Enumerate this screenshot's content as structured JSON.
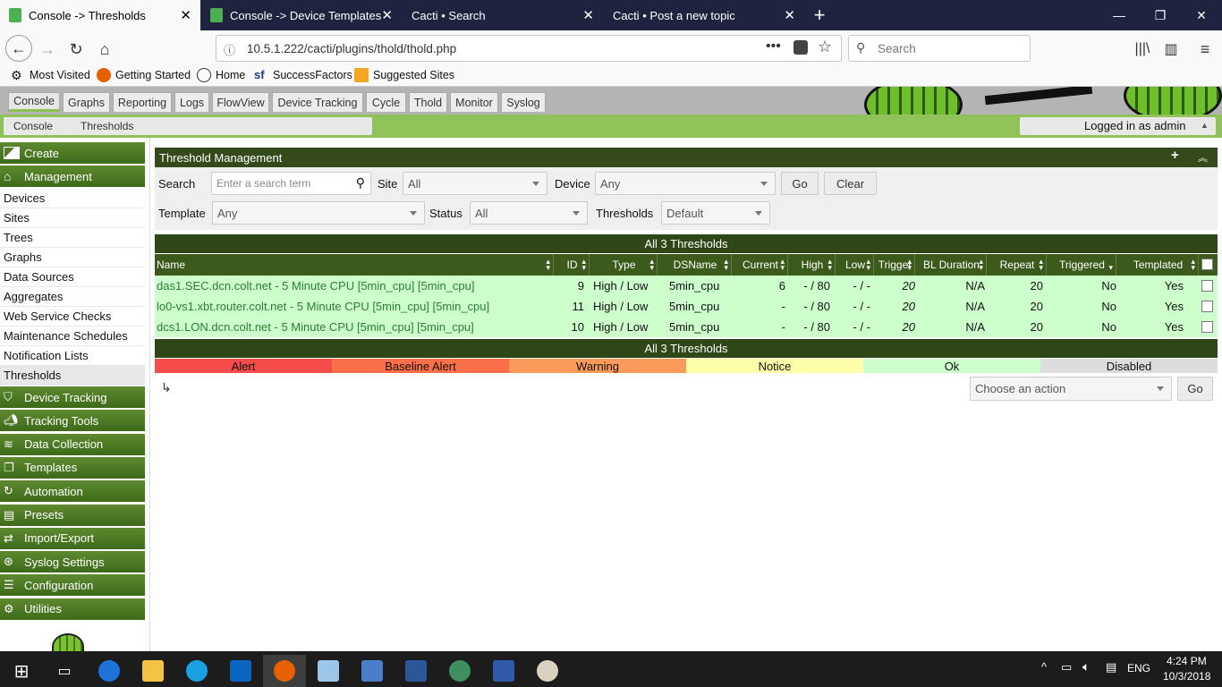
{
  "browser": {
    "tabs": [
      {
        "title": "Console -> Thresholds",
        "active": true
      },
      {
        "title": "Console -> Device Templates",
        "active": false
      },
      {
        "title": "Cacti • Search",
        "active": false
      },
      {
        "title": "Cacti • Post a new topic",
        "active": false
      }
    ],
    "url": "10.5.1.222/cacti/plugins/thold/thold.php",
    "search_placeholder": "Search",
    "bookmarks": [
      "Most Visited",
      "Getting Started",
      "Home",
      "SuccessFactors",
      "Suggested Sites"
    ]
  },
  "cacti": {
    "tabs": [
      "Console",
      "Graphs",
      "Reporting",
      "Logs",
      "FlowView",
      "Device Tracking",
      "Cycle",
      "Thold",
      "Monitor",
      "Syslog"
    ],
    "selected_tab": "Console",
    "breadcrumb": [
      "Console",
      "Thresholds"
    ],
    "logged_in": "Logged in as admin"
  },
  "sidebar": {
    "create": "Create",
    "management": "Management",
    "management_items": [
      "Devices",
      "Sites",
      "Trees",
      "Graphs",
      "Data Sources",
      "Aggregates",
      "Web Service Checks",
      "Maintenance Schedules",
      "Notification Lists",
      "Thresholds"
    ],
    "selected_item": "Thresholds",
    "sections": [
      "Device Tracking",
      "Tracking Tools",
      "Data Collection",
      "Templates",
      "Automation",
      "Presets",
      "Import/Export",
      "Syslog Settings",
      "Configuration",
      "Utilities"
    ]
  },
  "panel": {
    "title": "Threshold Management",
    "filter": {
      "search_label": "Search",
      "search_placeholder": "Enter a search term",
      "site_label": "Site",
      "site_value": "All",
      "device_label": "Device",
      "device_value": "Any",
      "go": "Go",
      "clear": "Clear",
      "template_label": "Template",
      "template_value": "Any",
      "status_label": "Status",
      "status_value": "All",
      "thresholds_label": "Thresholds",
      "thresholds_value": "Default"
    },
    "count_label": "All 3 Thresholds",
    "columns": [
      "Name",
      "ID",
      "Type",
      "DSName",
      "Current",
      "High",
      "Low",
      "Trigger",
      "BL Duration",
      "Repeat",
      "Triggered",
      "Templated"
    ],
    "rows": [
      {
        "name": "das1.SEC.dcn.colt.net - 5 Minute CPU [5min_cpu] [5min_cpu]",
        "id": "9",
        "type": "High / Low",
        "dsname": "5min_cpu",
        "current": "6",
        "high": "- / 80",
        "low": "- / -",
        "trigger": "20",
        "bl_duration": "N/A",
        "repeat": "20",
        "triggered": "No",
        "templated": "Yes"
      },
      {
        "name": "lo0-vs1.xbt.router.colt.net - 5 Minute CPU [5min_cpu] [5min_cpu]",
        "id": "11",
        "type": "High / Low",
        "dsname": "5min_cpu",
        "current": "-",
        "high": "- / 80",
        "low": "- / -",
        "trigger": "20",
        "bl_duration": "N/A",
        "repeat": "20",
        "triggered": "No",
        "templated": "Yes"
      },
      {
        "name": "dcs1.LON.dcn.colt.net - 5 Minute CPU [5min_cpu] [5min_cpu]",
        "id": "10",
        "type": "High / Low",
        "dsname": "5min_cpu",
        "current": "-",
        "high": "- / 80",
        "low": "- / -",
        "trigger": "20",
        "bl_duration": "N/A",
        "repeat": "20",
        "triggered": "No",
        "templated": "Yes"
      }
    ],
    "legend": [
      {
        "label": "Alert",
        "color": "#f44b4b"
      },
      {
        "label": "Baseline Alert",
        "color": "#fb7049"
      },
      {
        "label": "Warning",
        "color": "#fb9a5a"
      },
      {
        "label": "Notice",
        "color": "#ffffaa"
      },
      {
        "label": "Ok",
        "color": "#ccffcc"
      },
      {
        "label": "Disabled",
        "color": "#dddddd"
      }
    ],
    "action_placeholder": "Choose an action",
    "action_go": "Go"
  },
  "taskbar": {
    "lang": "ENG",
    "time": "4:24 PM",
    "date": "10/3/2018"
  },
  "colors": {
    "cacti_green": "#8fc35a",
    "header_dark": "#344a1a",
    "row_ok": "#ccffcc",
    "row_link": "#2e7d32"
  }
}
